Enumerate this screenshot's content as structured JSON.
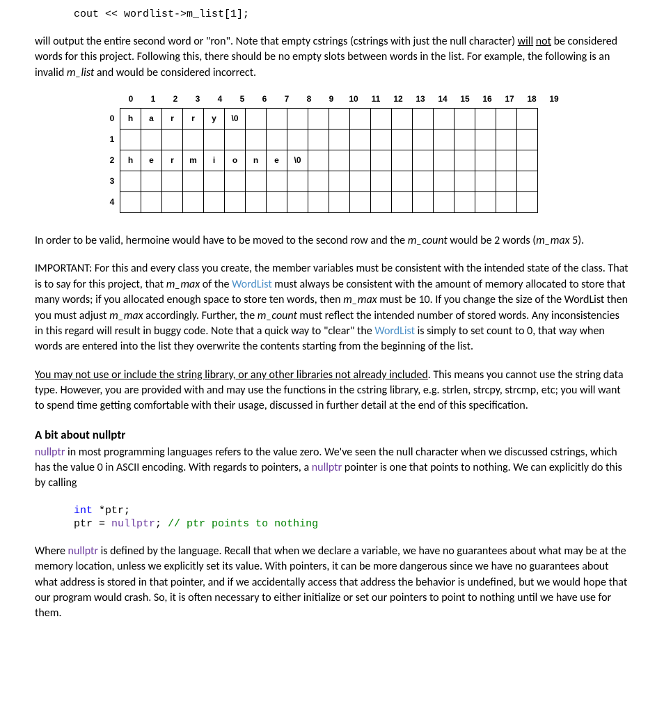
{
  "code1": "cout << wordlist->m_list[1];",
  "para1_a": "will output the entire second word or \"ron\".  Note that empty cstrings (cstrings with just the null character) ",
  "para1_will": "will",
  "para1_not": "not",
  "para1_b": " be considered words for this project.  Following this, there should be no empty slots between words in the list.  For example, the following is an invalid ",
  "para1_mlist": "m_list",
  "para1_c": " and would be considered incorrect.",
  "grid": {
    "cols": [
      "0",
      "1",
      "2",
      "3",
      "4",
      "5",
      "6",
      "7",
      "8",
      "9",
      "10",
      "11",
      "12",
      "13",
      "14",
      "15",
      "16",
      "17",
      "18",
      "19"
    ],
    "rows": [
      {
        "label": "0",
        "cells": [
          "h",
          "a",
          "r",
          "r",
          "y",
          "\\0",
          "",
          "",
          "",
          "",
          "",
          "",
          "",
          "",
          "",
          "",
          "",
          "",
          "",
          ""
        ]
      },
      {
        "label": "1",
        "cells": [
          "",
          "",
          "",
          "",
          "",
          "",
          "",
          "",
          "",
          "",
          "",
          "",
          "",
          "",
          "",
          "",
          "",
          "",
          "",
          ""
        ]
      },
      {
        "label": "2",
        "cells": [
          "h",
          "e",
          "r",
          "m",
          "i",
          "o",
          "n",
          "e",
          "\\0",
          "",
          "",
          "",
          "",
          "",
          "",
          "",
          "",
          "",
          "",
          ""
        ]
      },
      {
        "label": "3",
        "cells": [
          "",
          "",
          "",
          "",
          "",
          "",
          "",
          "",
          "",
          "",
          "",
          "",
          "",
          "",
          "",
          "",
          "",
          "",
          "",
          ""
        ]
      },
      {
        "label": "4",
        "cells": [
          "",
          "",
          "",
          "",
          "",
          "",
          "",
          "",
          "",
          "",
          "",
          "",
          "",
          "",
          "",
          "",
          "",
          "",
          "",
          ""
        ]
      }
    ]
  },
  "para2_a": "In order to be valid, hermoine would have to be moved to the second row and the ",
  "para2_mcount": "m_count",
  "para2_b": " would be 2 words (",
  "para2_mmax": "m_max",
  "para2_c": " 5).",
  "para3_a": "IMPORTANT:  For this and every class you create, the member variables must be consistent with the intended state of the class.  That is to say for this project,  that ",
  "para3_mmax1": "m_max",
  "para3_b": " of the ",
  "para3_wordlist1": "WordList",
  "para3_c": "  must always be consistent with the amount of memory allocated to store that many words; if you allocated enough space to store ten words, then ",
  "para3_mmax2": "m_max",
  "para3_d": " must be 10. If you change the size of the WordList then you must adjust ",
  "para3_mmax3": "m_max",
  "para3_e": " accordingly.  Further, the ",
  "para3_mcount": "m_count",
  "para3_f": " must reflect the intended number of stored words.  Any inconsistencies in this regard will result in buggy code. Note that a quick way to \"clear\" the ",
  "para3_wordlist2": "WordList",
  "para3_g": " is simply to set count to 0, that way when words are entered into the list they overwrite the contents starting from the beginning of the list.",
  "para4_u": "You may not use or include the string library, or any other libraries not already included",
  "para4_a": ".  This means you cannot use the string data type. However, you are provided with and may use the functions in the cstring library, e.g. strlen, strcpy, strcmp, etc; you will want to spend time getting comfortable with their usage,  discussed in further detail at the end of this specification.",
  "heading1": "A bit about nullptr",
  "para5_np1": "nullptr",
  "para5_a": " in most programming languages refers to the value zero.  We've seen the null character when we discussed cstrings, which has the value 0 in ASCII encoding.  With regards to pointers, a ",
  "para5_np2": "nullptr",
  "para5_b": " pointer is one that points to nothing.  We can explicitly do this by calling",
  "code2_int": "int",
  "code2_a": " *ptr;",
  "code2_b": "ptr = ",
  "code2_np": "nullptr",
  "code2_c": "; ",
  "code2_comment": "// ptr points to nothing",
  "para6_a": "Where ",
  "para6_np": "nullptr",
  "para6_b": " is defined by the language.  Recall that when we declare a variable, we have no guarantees about what may be at the memory location, unless we explicitly set its value.  With pointers, it can be more dangerous since we have no guarantees about what address is stored in that pointer, and if we accidentally access that address the behavior is undefined, but we would hope that our program would crash. So, it is often necessary to either initialize or set our pointers to point to nothing until we have use for them."
}
